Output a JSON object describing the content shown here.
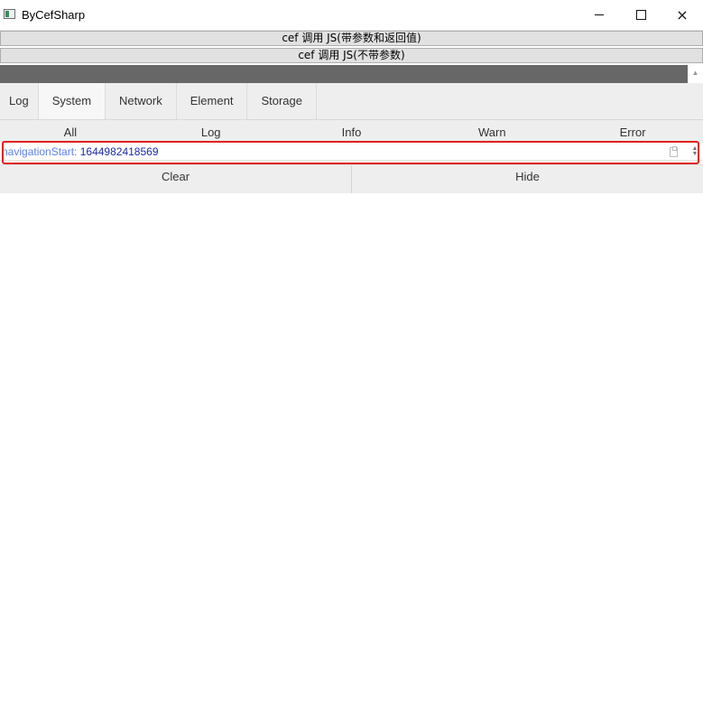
{
  "window": {
    "title": "ByCefSharp",
    "icon": "app-window-icon",
    "controls": {
      "minimize": "minimize-icon",
      "maximize": "maximize-icon",
      "close": "×"
    }
  },
  "page": {
    "buttons": [
      {
        "label": "cef 调用 JS(带参数和返回值)"
      },
      {
        "label": "cef 调用 JS(不带参数)"
      }
    ]
  },
  "console": {
    "tabs": [
      {
        "label": "Log"
      },
      {
        "label": "System",
        "active": true
      },
      {
        "label": "Network"
      },
      {
        "label": "Element"
      },
      {
        "label": "Storage"
      }
    ],
    "filters": [
      {
        "label": "All"
      },
      {
        "label": "Log"
      },
      {
        "label": "Info"
      },
      {
        "label": "Warn"
      },
      {
        "label": "Error"
      }
    ],
    "entries": [
      {
        "key": "navigationStart:",
        "value": "1644982418569"
      }
    ],
    "toolbar": {
      "clear_label": "Clear",
      "hide_label": "Hide"
    }
  },
  "colors": {
    "highlight": "#e02020",
    "header_bar": "#676767",
    "log_key": "#5c80e8",
    "log_value": "#1c2aa8"
  }
}
